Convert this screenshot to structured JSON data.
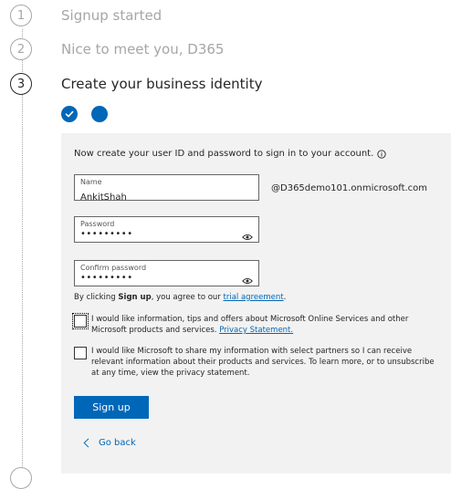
{
  "steps": [
    {
      "number": "1",
      "label": "Signup started",
      "state": "done"
    },
    {
      "number": "2",
      "label": "Nice to meet you, D365",
      "state": "done"
    },
    {
      "number": "3",
      "label": "Create your business identity",
      "state": "active"
    }
  ],
  "substep_progress": [
    "completed",
    "current"
  ],
  "form": {
    "intro": "Now create your user ID and password to sign in to your account.",
    "name_label": "Name",
    "name_value": "AnkitShah",
    "domain_suffix": "@D365demo101.onmicrosoft.com",
    "password_label": "Password",
    "password_value": "•••••••••",
    "confirm_label": "Confirm password",
    "confirm_value": "•••••••••",
    "agree_prefix": "By clicking ",
    "agree_bold": "Sign up",
    "agree_middle": ", you agree to our ",
    "agree_link": "trial agreement",
    "agree_suffix": ".",
    "checkbox1_text": "I would like information, tips and offers about Microsoft Online Services and other Microsoft products and services.",
    "checkbox1_link": "Privacy Statement.",
    "checkbox2_text": "I would like Microsoft to share my information with select partners so I can receive relevant information about their products and services. To learn more, or to unsubscribe at any time, view the privacy statement.",
    "signup_label": "Sign up",
    "back_label": "Go back"
  },
  "colors": {
    "accent": "#0067b8",
    "panel_bg": "#f2f2f2",
    "muted_text": "#a6a6a6"
  },
  "icons": [
    "checkmark-icon",
    "info-icon",
    "eye-icon",
    "chevron-left-icon"
  ]
}
